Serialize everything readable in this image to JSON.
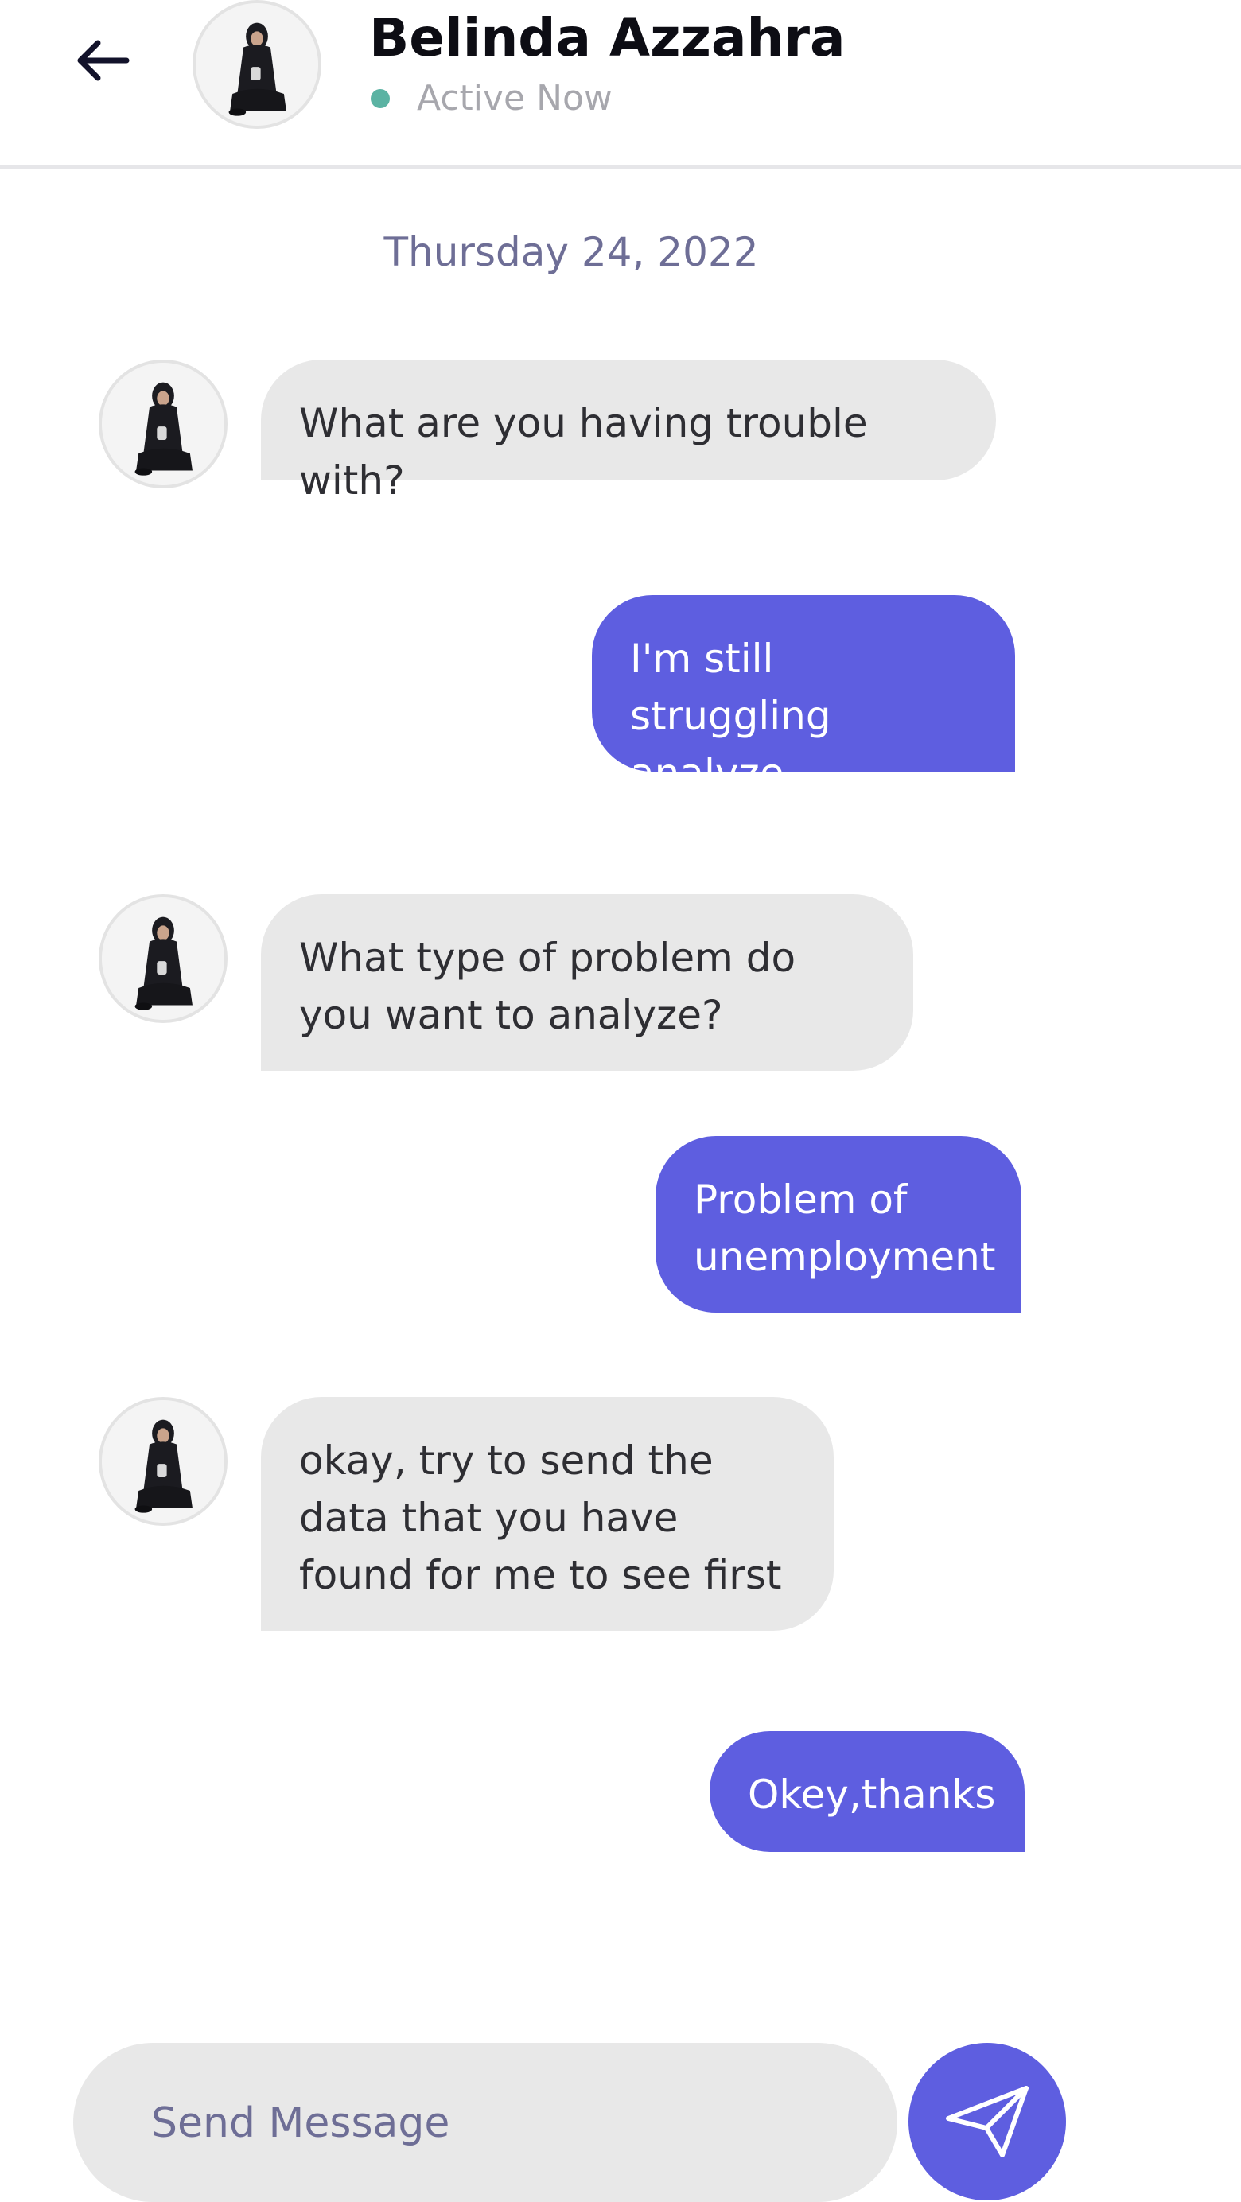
{
  "header": {
    "contact_name": "Belinda Azzahra",
    "status": "Active Now",
    "status_color": "#5bb3a3",
    "back_icon": "arrow-left-icon"
  },
  "date_separator": "Thursday 24, 2022",
  "messages": [
    {
      "from": "contact",
      "text": "What are you having trouble with?"
    },
    {
      "from": "me",
      "text": "I'm still struggling analyze problems"
    },
    {
      "from": "contact",
      "text": "What type of problem do you want to analyze?"
    },
    {
      "from": "me",
      "text": "Problem of unemployment"
    },
    {
      "from": "contact",
      "text": "okay, try to send the data that you have found for me to see first"
    },
    {
      "from": "me",
      "text": "Okey,thanks"
    }
  ],
  "composer": {
    "placeholder": "Send Message",
    "value": "",
    "send_icon": "paper-plane-icon"
  },
  "colors": {
    "accent": "#5e5ee0",
    "incoming_bubble": "#e8e8e8",
    "date_text": "#6e6e96"
  }
}
